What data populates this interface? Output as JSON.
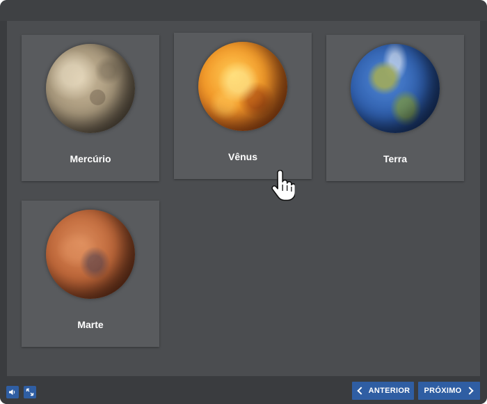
{
  "planets": [
    {
      "label": "Mercúrio",
      "icon": "mercury-planet-icon"
    },
    {
      "label": "Vênus",
      "icon": "venus-planet-icon"
    },
    {
      "label": "Terra",
      "icon": "earth-planet-icon"
    },
    {
      "label": "Marte",
      "icon": "mars-planet-icon"
    }
  ],
  "controls": {
    "audio_icon": "speaker-icon",
    "fullscreen_icon": "expand-icon",
    "prev_label": "ANTERIOR",
    "next_label": "PRÓXIMO"
  },
  "colors": {
    "button_blue": "#2f5ea3",
    "card_bg": "#595b5e",
    "stage_bg": "#4b4d50"
  }
}
